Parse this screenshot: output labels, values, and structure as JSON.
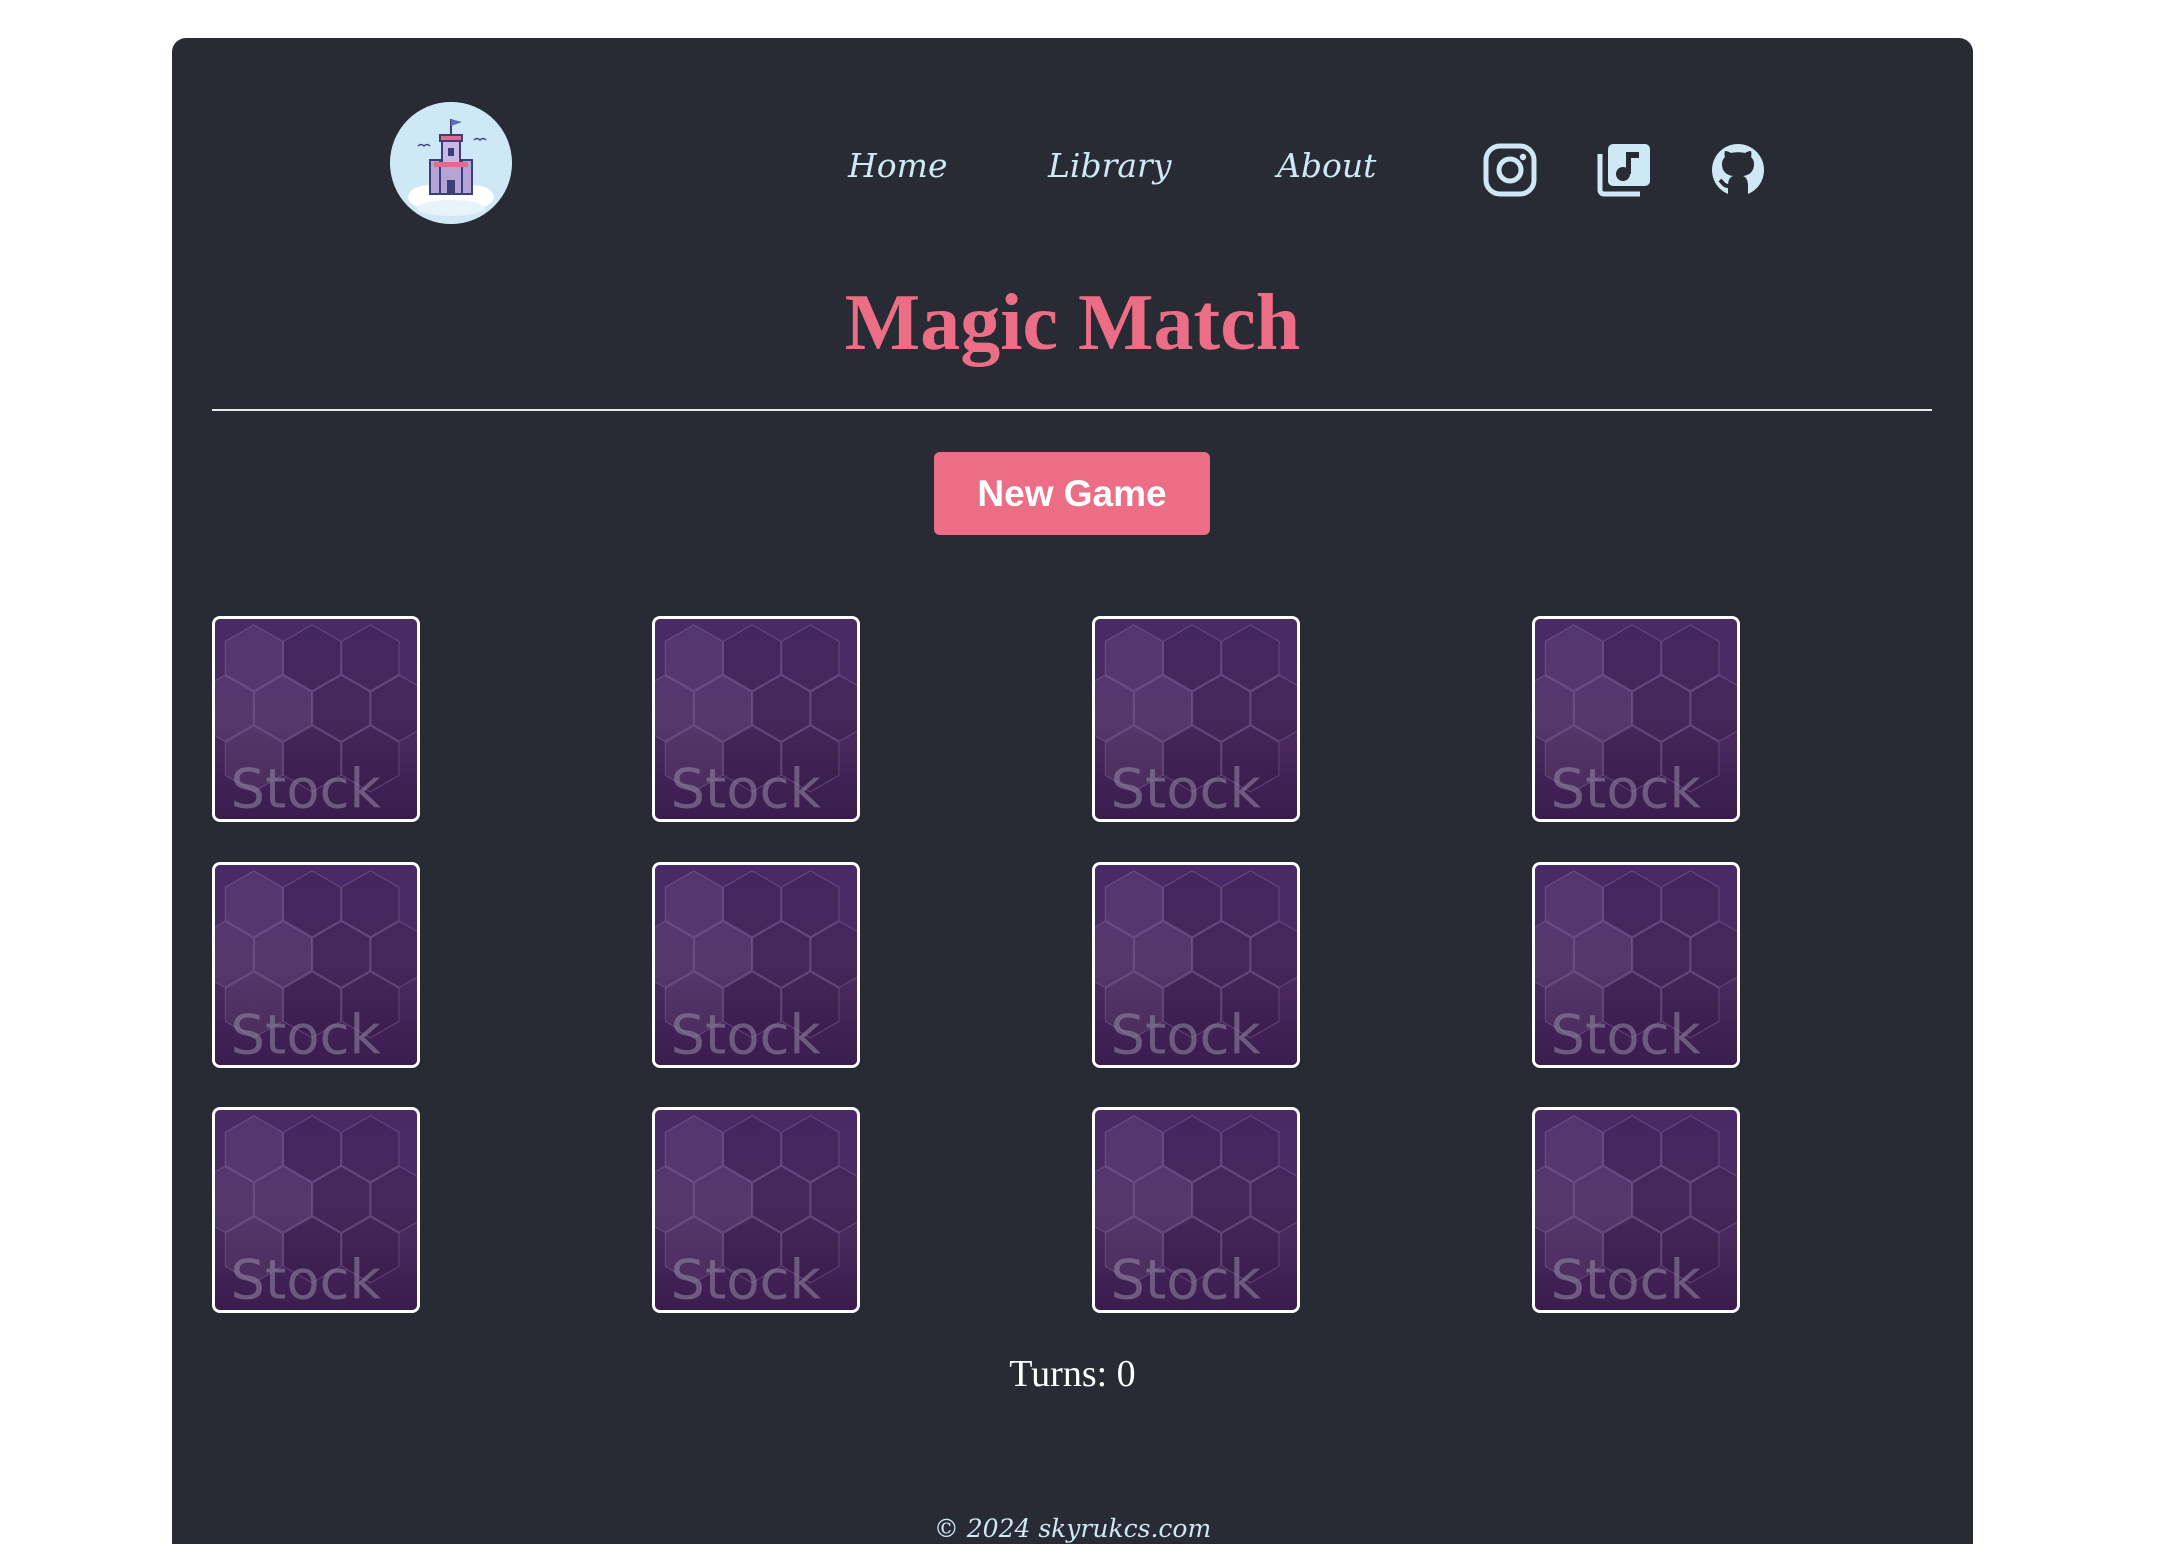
{
  "nav": {
    "home": "Home",
    "library": "Library",
    "about": "About"
  },
  "social": [
    "instagram-icon",
    "music-library-icon",
    "github-icon"
  ],
  "game": {
    "title": "Magic Match",
    "new_game_label": "New Game",
    "turns_label": "Turns: 0",
    "turns": 0,
    "card_back_text": "Stock",
    "card_count": 12
  },
  "footer": {
    "copyright": "© 2024 skyrukcs.com"
  },
  "colors": {
    "panel": "#282b33",
    "accent": "#eb6e86",
    "link": "#cfe8f5",
    "card_back": "#3e2150"
  }
}
